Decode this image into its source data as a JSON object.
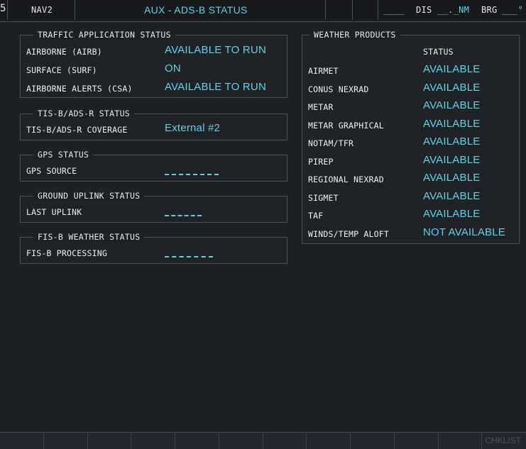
{
  "topbar": {
    "left_digit": "5",
    "nav_label": "NAV2",
    "title": "AUX - ADS-B STATUS",
    "dist_blank": "____",
    "dis_label": "DIS",
    "dis_value": "__._NM",
    "brg_label": "BRG",
    "brg_value": "___°"
  },
  "traffic": {
    "title": "TRAFFIC APPLICATION STATUS",
    "rows": [
      {
        "label": "AIRBORNE (AIRB)",
        "value": "AVAILABLE TO RUN"
      },
      {
        "label": "SURFACE (SURF)",
        "value": "ON"
      },
      {
        "label": "AIRBORNE ALERTS (CSA)",
        "value": "AVAILABLE TO RUN"
      }
    ]
  },
  "tis": {
    "title": "TIS-B/ADS-R STATUS",
    "label": "TIS-B/ADS-R COVERAGE",
    "value": "External #2"
  },
  "gps": {
    "title": "GPS STATUS",
    "label": "GPS SOURCE"
  },
  "uplink": {
    "title": "GROUND UPLINK STATUS",
    "label": "LAST UPLINK"
  },
  "fisb": {
    "title": "FIS-B WEATHER STATUS",
    "label": "FIS-B PROCESSING"
  },
  "weather": {
    "title": "WEATHER PRODUCTS",
    "status_header": "STATUS",
    "rows": [
      {
        "label": "AIRMET",
        "value": "AVAILABLE"
      },
      {
        "label": "CONUS NEXRAD",
        "value": "AVAILABLE"
      },
      {
        "label": "METAR",
        "value": "AVAILABLE"
      },
      {
        "label": "METAR GRAPHICAL",
        "value": "AVAILABLE"
      },
      {
        "label": "NOTAM/TFR",
        "value": "AVAILABLE"
      },
      {
        "label": "PIREP",
        "value": "AVAILABLE"
      },
      {
        "label": "REGIONAL NEXRAD",
        "value": "AVAILABLE"
      },
      {
        "label": "SIGMET",
        "value": "AVAILABLE"
      },
      {
        "label": "TAF",
        "value": "AVAILABLE"
      },
      {
        "label": "WINDS/TEMP ALOFT",
        "value": "NOT AVAILABLE"
      }
    ]
  },
  "softkeys": {
    "last_label": "CHKLIST"
  },
  "colors": {
    "background": "#1d2126",
    "value_cyan": "#5fd3e8",
    "label_white": "#f0f0f0"
  }
}
